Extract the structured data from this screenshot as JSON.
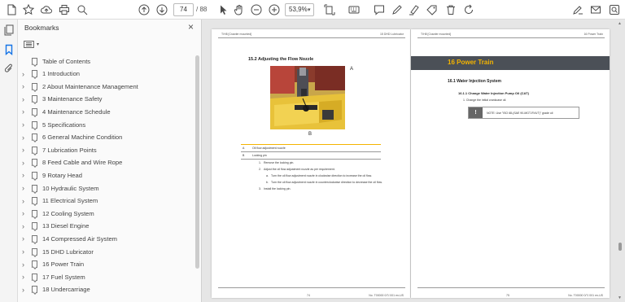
{
  "toolbar": {
    "page_current": "74",
    "page_total": "/ 88",
    "zoom": "53,9%"
  },
  "panel": {
    "title": "Bookmarks",
    "close_label": "×",
    "items": [
      {
        "label": "Table of Contents",
        "expandable": false
      },
      {
        "label": "1 Introduction",
        "expandable": true
      },
      {
        "label": "2 About Maintenance Management",
        "expandable": true
      },
      {
        "label": "3 Maintenance Safety",
        "expandable": true
      },
      {
        "label": "4 Maintenance Schedule",
        "expandable": true
      },
      {
        "label": "5 Specifications",
        "expandable": true
      },
      {
        "label": "6 General Machine Condition",
        "expandable": true
      },
      {
        "label": "7 Lubrication Points",
        "expandable": true
      },
      {
        "label": "8 Feed Cable and Wire Rope",
        "expandable": true
      },
      {
        "label": "9 Rotary Head",
        "expandable": true
      },
      {
        "label": "10 Hydraulic System",
        "expandable": true
      },
      {
        "label": "11 Electrical System",
        "expandable": true
      },
      {
        "label": "12 Cooling System",
        "expandable": true
      },
      {
        "label": "13 Diesel Engine",
        "expandable": true
      },
      {
        "label": "14 Compressed Air System",
        "expandable": true
      },
      {
        "label": "15 DHD Lubricator",
        "expandable": true
      },
      {
        "label": "16 Power Train",
        "expandable": true
      },
      {
        "label": "17 Fuel System",
        "expandable": true
      },
      {
        "label": "18 Undercarriage",
        "expandable": true
      }
    ]
  },
  "left_page": {
    "header_left": "T/H8 [Crawler mounted]",
    "header_right": "15 DHD Lubricator",
    "section_title": "15.2   Adjusting the Flow Nozzle",
    "label_a": "A",
    "label_b": "B",
    "legend": [
      {
        "key": "A",
        "value": "Oil flow adjustment nozzle"
      },
      {
        "key": "B",
        "value": "Locking pin"
      }
    ],
    "steps": [
      {
        "n": "1.",
        "text": "Remove the locking pin."
      },
      {
        "n": "2.",
        "text": "Adjust the oil flow adjustment nozzle as per requirement."
      },
      {
        "n": "a.",
        "text": "Turn the oil flow adjustment nozzle in clockwise direction to increase the oil flow.",
        "sub": true
      },
      {
        "n": "b.",
        "text": "Turn the oil flow adjustment nozzle in counterclockwise direction to decrease the oil flow.",
        "sub": true
      },
      {
        "n": "3.",
        "text": "Install the locking pin."
      }
    ],
    "footer_page": "74",
    "footer_doc": "No. T00000 0/7/.001 en-US"
  },
  "right_page": {
    "header_left": "T/H8 [Crawler mounted]",
    "header_right": "16 Power Train",
    "banner": "16  Power Train",
    "section": "16.1   Water Injection System",
    "subsection": "16.1.1 Change Water Injection Pump Oil (CAT)",
    "item": "1.   Change the initial crankcase oil.",
    "note_icon": "!",
    "note_text": "NOTE: Use \"ISO 68-(SAE 90-MGT-RVUT)\" grade oil",
    "footer_page": "75",
    "footer_doc": "No. T00000 0/7/.001 en-US"
  },
  "colors": {
    "accent_yellow": "#f4b400",
    "banner_gray": "#4b5057",
    "link_blue": "#1473e6"
  }
}
